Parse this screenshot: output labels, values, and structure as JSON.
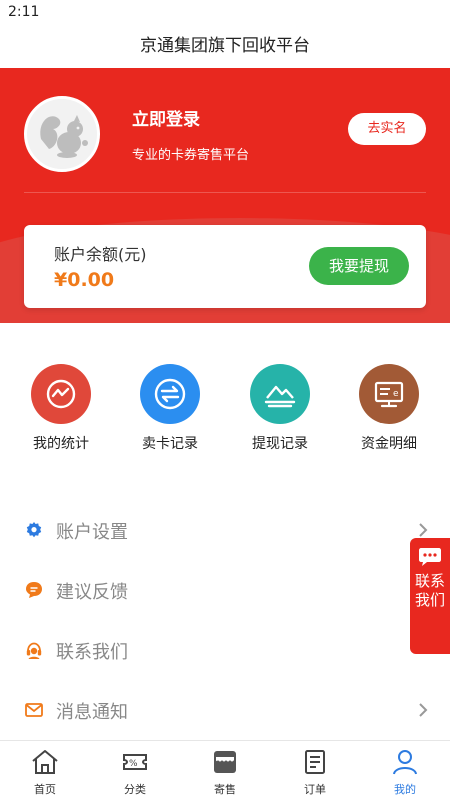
{
  "status_bar": {
    "time": "2:11"
  },
  "header": {
    "title": "京通集团旗下回收平台"
  },
  "profile": {
    "login_title": "立即登录",
    "subtitle": "专业的卡券寄售平台",
    "verify_label": "去实名"
  },
  "balance": {
    "label": "账户余额(元)",
    "value": "¥0.00",
    "withdraw_label": "我要提现"
  },
  "quick_actions": [
    {
      "label": "我的统计",
      "icon": "statistics-icon",
      "color": "#e0483a"
    },
    {
      "label": "卖卡记录",
      "icon": "exchange-icon",
      "color": "#2b8ef0"
    },
    {
      "label": "提现记录",
      "icon": "landscape-icon",
      "color": "#26b3a9"
    },
    {
      "label": "资金明细",
      "icon": "monitor-icon",
      "color": "#a25a36"
    }
  ],
  "menu": [
    {
      "label": "账户设置",
      "icon": "gear-icon",
      "icon_color": "#2d7be0"
    },
    {
      "label": "建议反馈",
      "icon": "feedback-icon",
      "icon_color": "#f07a1a"
    },
    {
      "label": "联系我们",
      "icon": "headset-icon",
      "icon_color": "#f07a1a"
    },
    {
      "label": "消息通知",
      "icon": "mail-icon",
      "icon_color": "#f07a1a"
    }
  ],
  "float_contact": {
    "label": "联系我们"
  },
  "tabbar": [
    {
      "label": "首页",
      "icon": "home-icon",
      "active": false
    },
    {
      "label": "分类",
      "icon": "ticket-icon",
      "active": false
    },
    {
      "label": "寄售",
      "icon": "store-icon",
      "active": false
    },
    {
      "label": "订单",
      "icon": "order-icon",
      "active": false
    },
    {
      "label": "我的",
      "icon": "user-icon",
      "active": true
    }
  ],
  "colors": {
    "brand_red": "#e8281f",
    "accent_orange": "#f07a1a",
    "success_green": "#3bb34a",
    "active_blue": "#2d7be0"
  }
}
